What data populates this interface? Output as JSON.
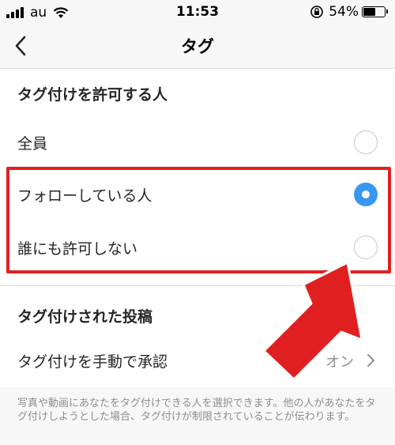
{
  "status_bar": {
    "carrier": "au",
    "time": "11:53",
    "battery": "54%",
    "battery_level": 0.54
  },
  "nav": {
    "title": "タグ",
    "back_icon": "chevron-left-icon"
  },
  "section_allow": {
    "header": "タグ付けを許可する人",
    "options": [
      {
        "label": "全員",
        "selected": false
      },
      {
        "label": "フォローしている人",
        "selected": true
      },
      {
        "label": "誰にも許可しない",
        "selected": false
      }
    ]
  },
  "section_tagged_posts": {
    "header": "タグ付けされた投稿",
    "manual_approve": {
      "label": "タグ付けを手動で承認",
      "value": "オン"
    },
    "footnote": "写真や動画にあなたをタグ付けできる人を選択できます。他の人があなたをタグ付けしようとした場合、タグ付けが制限されていることが伝わります。"
  },
  "colors": {
    "accent": "#3897f0",
    "annotation": "#e02020",
    "secondary_text": "#8e8e8e"
  }
}
